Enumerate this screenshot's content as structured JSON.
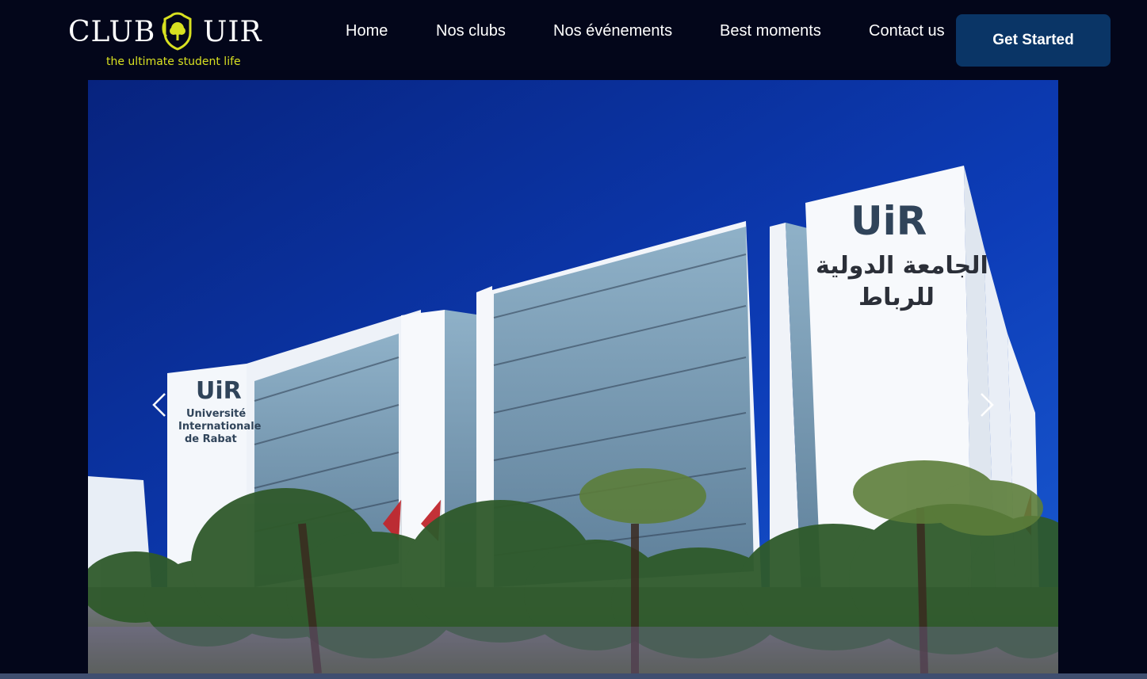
{
  "brand": {
    "title_left": "CLUB",
    "title_right": "UIR",
    "tagline": "the ultimate student life",
    "accent_color": "#d8e021"
  },
  "nav": {
    "items": [
      {
        "label": "Home"
      },
      {
        "label": "Nos clubs"
      },
      {
        "label": "Nos événements"
      },
      {
        "label": "Best moments"
      },
      {
        "label": "Contact us"
      }
    ]
  },
  "cta": {
    "label": "Get Started",
    "color": "#0a3566"
  },
  "hero": {
    "signage_fr_line1": "Université",
    "signage_fr_line2": "Internationale",
    "signage_fr_line3": "de Rabat",
    "signage_ar_line1": "الجامعة الدولية",
    "signage_ar_line2": "للرباط",
    "logo_mark": "UiR",
    "prev_icon": "chevron-left-icon",
    "next_icon": "chevron-right-icon"
  },
  "theme": {
    "background": "#03061a",
    "sky": "#0b2fa0",
    "strip": "#3f4e6f"
  }
}
